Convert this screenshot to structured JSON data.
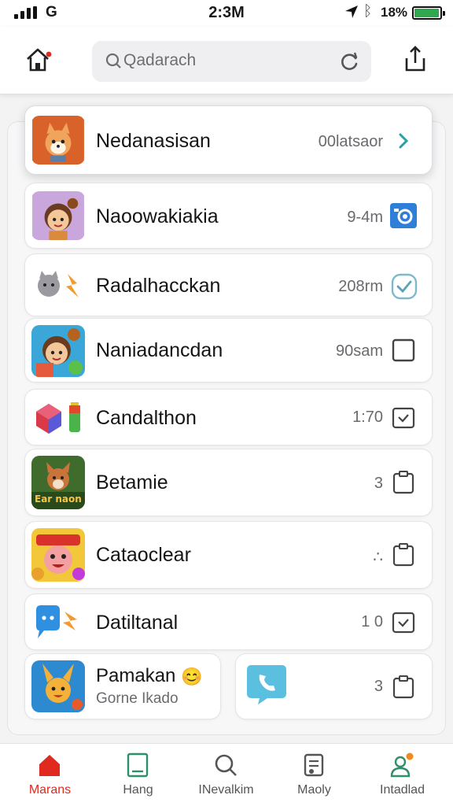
{
  "status_bar": {
    "network": "G",
    "time": "2:3M",
    "battery_text": "18%",
    "battery_level": 0.85,
    "battery_color": "#2fa84f"
  },
  "header": {
    "home_icon": "home-alert-icon",
    "search": {
      "text": "Qadarach",
      "refresh_icon": "refresh-icon"
    },
    "share_icon": "share-icon"
  },
  "list": [
    {
      "title": "Nedanasisan",
      "meta": "00latsaor",
      "action_icon": "chevron-right-icon",
      "avatar": "fox-character-avatar"
    },
    {
      "title": "Naoowakiakia",
      "meta": "9-4m",
      "action_icon": "camera-badge-icon",
      "avatar": "girl-character-avatar"
    },
    {
      "title": "Radalhacckan",
      "meta": "208rm",
      "action_icon": "check-circle-icon",
      "avatar": "cat-and-lightning-avatar"
    },
    {
      "title": "Naniadancdan",
      "meta": "90sam",
      "action_icon": "checkbox-icon",
      "avatar": "girl-character-avatar-2"
    },
    {
      "title": "Candalthon",
      "meta": "1:70",
      "action_icon": "checkbox-check-icon",
      "avatar": "cube-and-battery-avatar"
    },
    {
      "title": "Betamie",
      "meta": "3",
      "action_icon": "clipboard-icon",
      "avatar": "fox-game-avatar",
      "avatar_caption": "Ear naon"
    },
    {
      "title": "Cataoclear",
      "meta": "∴",
      "action_icon": "clipboard-icon",
      "avatar": "mask-character-avatar"
    },
    {
      "title": "Datiltanal",
      "meta": "1 0",
      "action_icon": "checkbox-check-icon",
      "avatar": "chat-bubble-avatar"
    },
    {
      "title": "Pamakan",
      "subtitle": "Gorne Ikado",
      "meta": "3",
      "action_icon": "clipboard-icon",
      "avatar": "bunny-character-avatar",
      "extra_icon": "phone-bubble-icon"
    }
  ],
  "bottom_nav": [
    {
      "label": "Marans",
      "icon": "home-icon",
      "active": true
    },
    {
      "label": "Hang",
      "icon": "tablet-icon",
      "active": false
    },
    {
      "label": "INevalkim",
      "icon": "search-icon",
      "active": false
    },
    {
      "label": "Maoly",
      "icon": "music-note-icon",
      "active": false
    },
    {
      "label": "Intadlad",
      "icon": "user-notification-icon",
      "active": false
    }
  ],
  "colors": {
    "accent_active": "#e02a20",
    "teal": "#2aa1a4",
    "blue_badge": "#2f7fd8"
  }
}
